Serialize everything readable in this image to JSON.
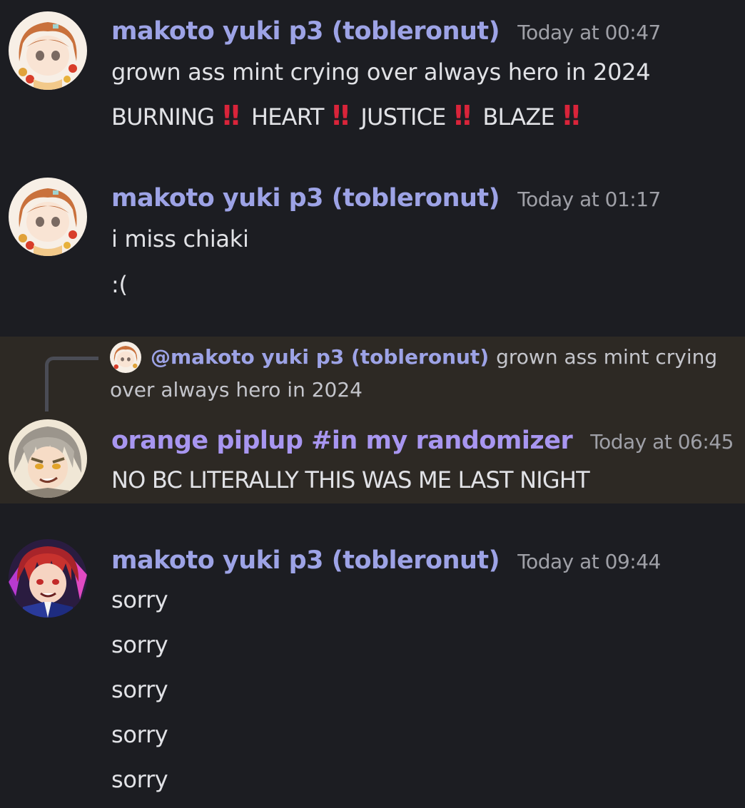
{
  "messages": [
    {
      "username": "makoto yuki p3 (tobleronut)",
      "timestamp": "Today at 00:47",
      "lines": [
        "grown ass mint crying over always hero in 2024"
      ],
      "caps_line": {
        "words": [
          "BURNING",
          "HEART",
          "JUSTICE",
          "BLAZE"
        ],
        "emoji": "‼"
      }
    },
    {
      "username": "makoto yuki p3 (tobleronut)",
      "timestamp": "Today at 01:17",
      "lines": [
        "i miss chiaki",
        ":("
      ]
    },
    {
      "reply": {
        "mention": "@makoto yuki p3 (tobleronut)",
        "text": "grown ass mint crying over always hero in 2024"
      },
      "username": "orange piplup #in my randomizer",
      "timestamp": "Today at 06:45",
      "lines": [
        "NO BC LITERALLY THIS WAS ME LAST NIGHT"
      ]
    },
    {
      "username": "makoto yuki p3 (tobleronut)",
      "timestamp": "Today at 09:44",
      "lines": [
        "sorry",
        "sorry",
        "sorry",
        "sorry",
        "sorry"
      ]
    }
  ],
  "colors": {
    "background": "#1c1d22",
    "highlight_background": "#2d2924",
    "username": "#9da3e6",
    "username_alt": "#a896f0",
    "timestamp": "#9fa0a7",
    "text": "#e1e2e6",
    "emoji_red": "#d9243a"
  },
  "icons": {
    "avatar_1": "orange-haired-girl-avatar",
    "avatar_2": "gray-haired-boy-avatar",
    "avatar_3": "red-haired-boy-avatar",
    "emoji": "double-exclamation-mark"
  }
}
